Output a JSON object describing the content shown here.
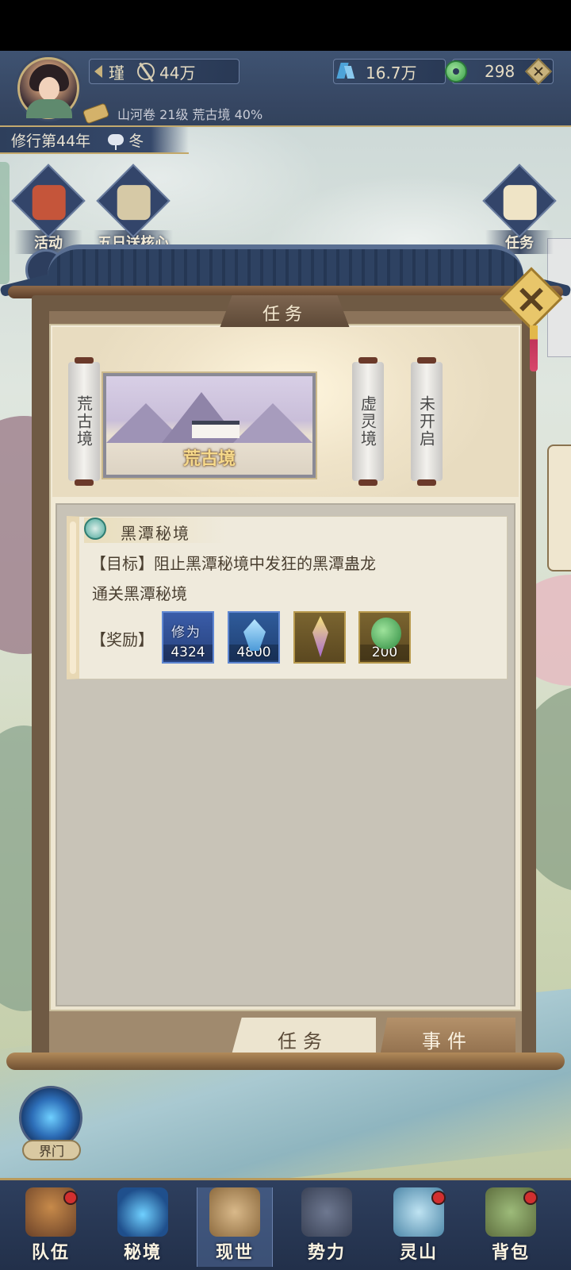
{
  "header": {
    "player_name": "瑾",
    "power": "44万",
    "crystal": "16.7万",
    "jade": "298",
    "progress": "山河卷 21级 荒古境 40%",
    "year": "修行第44年",
    "season": "冬"
  },
  "activities": [
    {
      "label": "活动"
    },
    {
      "label": "五日送核心"
    },
    {
      "label": "任务"
    }
  ],
  "panel": {
    "title": "任务",
    "realms": {
      "left": "荒古境",
      "selected": "荒古境",
      "mid": "虚灵境",
      "right": "未开启"
    },
    "quest": {
      "title": "黑潭秘境",
      "goal_line1": "【目标】阻止黑潭秘境中发狂的黑潭蛊龙",
      "goal_line2": "通关黑潭秘境",
      "reward_label": "【奖励】",
      "rewards": [
        {
          "name": "修为",
          "qty": "4324"
        },
        {
          "name": "",
          "qty": "4800"
        },
        {
          "name": "",
          "qty": ""
        },
        {
          "name": "",
          "qty": "200"
        }
      ]
    },
    "tabs": {
      "task": "任务",
      "event": "事件"
    }
  },
  "portal": {
    "label": "界门"
  },
  "nav": [
    {
      "label": "队伍",
      "badge": true
    },
    {
      "label": "秘境",
      "badge": false
    },
    {
      "label": "现世",
      "badge": false,
      "active": true
    },
    {
      "label": "势力",
      "badge": false
    },
    {
      "label": "灵山",
      "badge": true
    },
    {
      "label": "背包",
      "badge": true
    }
  ],
  "colors": {
    "header_bg": "#2c3c58",
    "gold_accent": "#c3a86a",
    "panel_paper": "#ece4cf",
    "badge_red": "#d22f2f"
  }
}
